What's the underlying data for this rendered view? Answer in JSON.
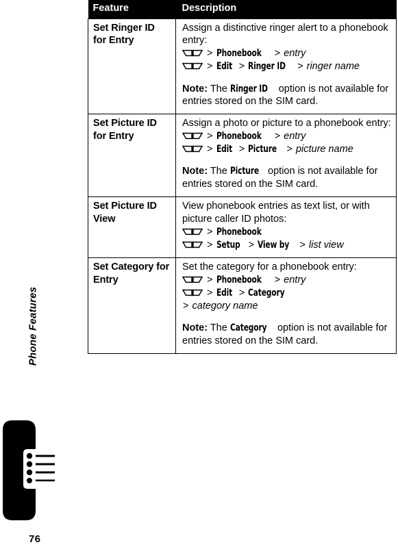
{
  "sidebar": {
    "chapter_label": "Phone Features",
    "page_number": "76",
    "tab_icon": "menu-list-tab-icon"
  },
  "table": {
    "headers": {
      "feature": "Feature",
      "description": "Description"
    },
    "rows": [
      {
        "feature": "Set Ringer ID for Entry",
        "intro": "Assign a distinctive ringer alert to a phonebook entry:",
        "paths": [
          {
            "icon": "menu-key-icon",
            "items": [
              "Phonebook",
              "entry"
            ],
            "styles": [
              "menu",
              "var"
            ]
          },
          {
            "icon": "menu-key-icon",
            "items": [
              "Edit",
              "Ringer ID",
              "ringer name"
            ],
            "styles": [
              "menu",
              "menu",
              "var"
            ]
          }
        ],
        "note_label": "Note:",
        "note_before": "The",
        "note_menu": "Ringer ID",
        "note_after": "option is not available for entries stored on the SIM card."
      },
      {
        "feature": "Set Picture ID for Entry",
        "intro": "Assign a photo or picture to a phonebook entry:",
        "paths": [
          {
            "icon": "menu-key-icon",
            "items": [
              "Phonebook",
              "entry"
            ],
            "styles": [
              "menu",
              "var"
            ]
          },
          {
            "icon": "menu-key-icon",
            "items": [
              "Edit",
              "Picture",
              "picture name"
            ],
            "styles": [
              "menu",
              "menu",
              "var"
            ]
          }
        ],
        "note_label": "Note:",
        "note_before": "The",
        "note_menu": "Picture",
        "note_after": "option is not available for entries stored on the SIM card."
      },
      {
        "feature": "Set Picture ID View",
        "intro": "View phonebook entries as text list, or with picture caller ID photos:",
        "paths": [
          {
            "icon": "menu-key-icon",
            "items": [
              "Phonebook"
            ],
            "styles": [
              "menu"
            ]
          },
          {
            "icon": "menu-key-icon",
            "items": [
              "Setup",
              "View by",
              "list view"
            ],
            "styles": [
              "menu",
              "menu",
              "var"
            ]
          }
        ],
        "note_label": "",
        "note_before": "",
        "note_menu": "",
        "note_after": ""
      },
      {
        "feature": "Set Category for Entry",
        "intro": "Set the category for a phonebook entry:",
        "paths": [
          {
            "icon": "menu-key-icon",
            "items": [
              "Phonebook",
              "entry"
            ],
            "styles": [
              "menu",
              "var"
            ]
          },
          {
            "icon": "menu-key-icon",
            "items": [
              "Edit",
              "Category"
            ],
            "styles": [
              "menu",
              "menu"
            ]
          },
          {
            "icon": "",
            "items": [
              "category name"
            ],
            "styles": [
              "var"
            ]
          }
        ],
        "note_label": "Note:",
        "note_before": "The",
        "note_menu": "Category",
        "note_after": "option is not available for entries stored on the SIM card."
      }
    ]
  },
  "colors": {
    "text": "#000000",
    "background": "#ffffff",
    "header_background": "#000000",
    "header_text": "#ffffff",
    "rule": "#000000"
  }
}
